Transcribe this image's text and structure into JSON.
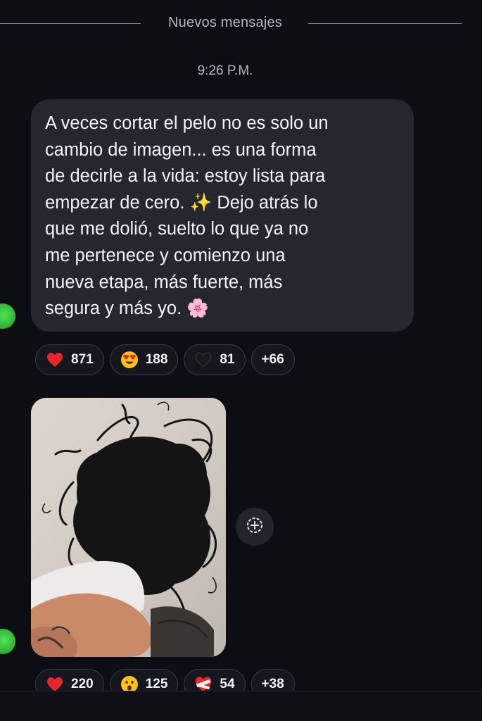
{
  "divider": {
    "label": "Nuevos mensajes"
  },
  "message": {
    "timestamp": "9:26 P.M.",
    "text": "A veces cortar el pelo no es solo un\ncambio de imagen... es una forma\nde decirle a la vida: estoy lista para\nempezar de cero. ✨ Dejo atrás lo\nque me dolió, suelto lo que ya no\nme pertenece y comienzo una\nnueva etapa, más fuerte, más\nsegura y más yo. 🌸",
    "reactions": [
      {
        "icon": "red-heart-icon",
        "count": "871"
      },
      {
        "icon": "heart-eyes-emoji-icon",
        "count": "188"
      },
      {
        "icon": "black-heart-icon",
        "count": "81"
      }
    ],
    "more_reactions": "+66"
  },
  "photo_message": {
    "image_icon": "photo-of-cut-black-hair",
    "reactions": [
      {
        "icon": "red-heart-icon",
        "count": "220"
      },
      {
        "icon": "astonished-face-emoji-icon",
        "count": "125"
      },
      {
        "icon": "bandaged-heart-icon",
        "count": "54"
      }
    ],
    "more_reactions": "+38",
    "action_icon": "add-reaction-icon"
  },
  "colors": {
    "background": "#0d0e14",
    "bubble": "#25262e",
    "presence_dot": "#2fb434",
    "secondary_text": "#b7b8bf"
  }
}
